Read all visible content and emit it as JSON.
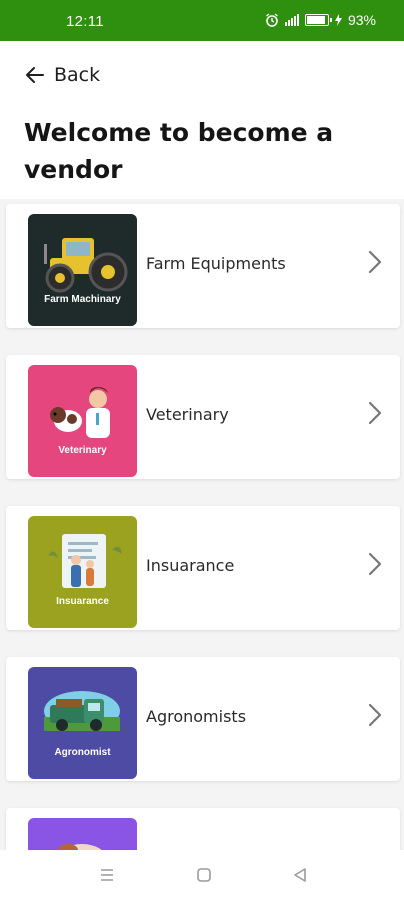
{
  "status_bar": {
    "time": "12:11",
    "battery": "93%"
  },
  "header": {
    "back_label": "Back",
    "title": "Welcome to  become a vendor"
  },
  "vendors": [
    {
      "label": "Farm Equipments",
      "caption": "Farm Machinary",
      "color": "#1f2a2a"
    },
    {
      "label": "Veterinary",
      "caption": "Veterinary",
      "color": "#e6467e"
    },
    {
      "label": "Insuarance",
      "caption": "Insuarance",
      "color": "#9aa21f"
    },
    {
      "label": "Agronomists",
      "caption": "Agronomist",
      "color": "#4d4ba3"
    },
    {
      "label": "",
      "caption": "",
      "color": "#8a55e4"
    }
  ],
  "colors": {
    "status_bar": "#2f8f0f",
    "page_bg": "#ffffff",
    "divider_bg": "#f4f4f4"
  }
}
